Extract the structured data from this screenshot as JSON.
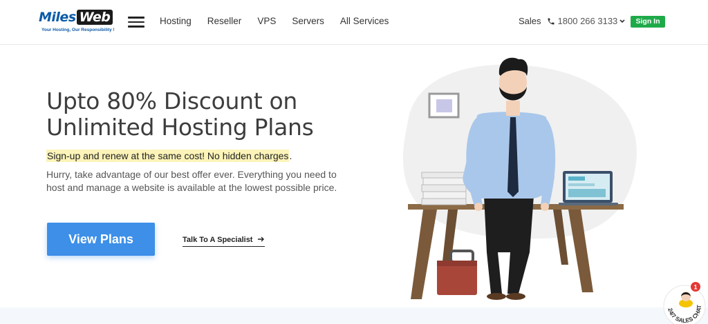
{
  "brand": {
    "logo_miles": "Miles",
    "logo_web": "Web",
    "tagline": "Your Hosting, Our Responsibility !"
  },
  "nav": {
    "items": [
      {
        "label": "Hosting"
      },
      {
        "label": "Reseller"
      },
      {
        "label": "VPS"
      },
      {
        "label": "Servers"
      },
      {
        "label": "All Services"
      }
    ]
  },
  "header": {
    "sales_label": "Sales",
    "phone": "1800 266 3133",
    "signin_label": "Sign In"
  },
  "hero": {
    "title_line1": "Upto 80% Discount on",
    "title_line2": "Unlimited Hosting Plans",
    "highlight": "Sign-up and renew at the same cost! No hidden charges",
    "highlight_end": ".",
    "description": "Hurry, take advantage of our best offer ever. Everything you need to host and manage a website is available at the lowest possible price.",
    "cta_primary": "View Plans",
    "cta_secondary": "Talk To A Specialist"
  },
  "chat_widget": {
    "label": "24/7 SALES CHAT",
    "badge_count": "1"
  },
  "colors": {
    "brand_blue": "#0b5aa8",
    "signin_green": "#1faa4a",
    "cta_blue": "#3d8fe8",
    "highlight_yellow": "#fbf3b8"
  },
  "icons": [
    "hamburger-menu-icon",
    "phone-icon",
    "chevron-down-icon",
    "arrow-right-icon"
  ]
}
